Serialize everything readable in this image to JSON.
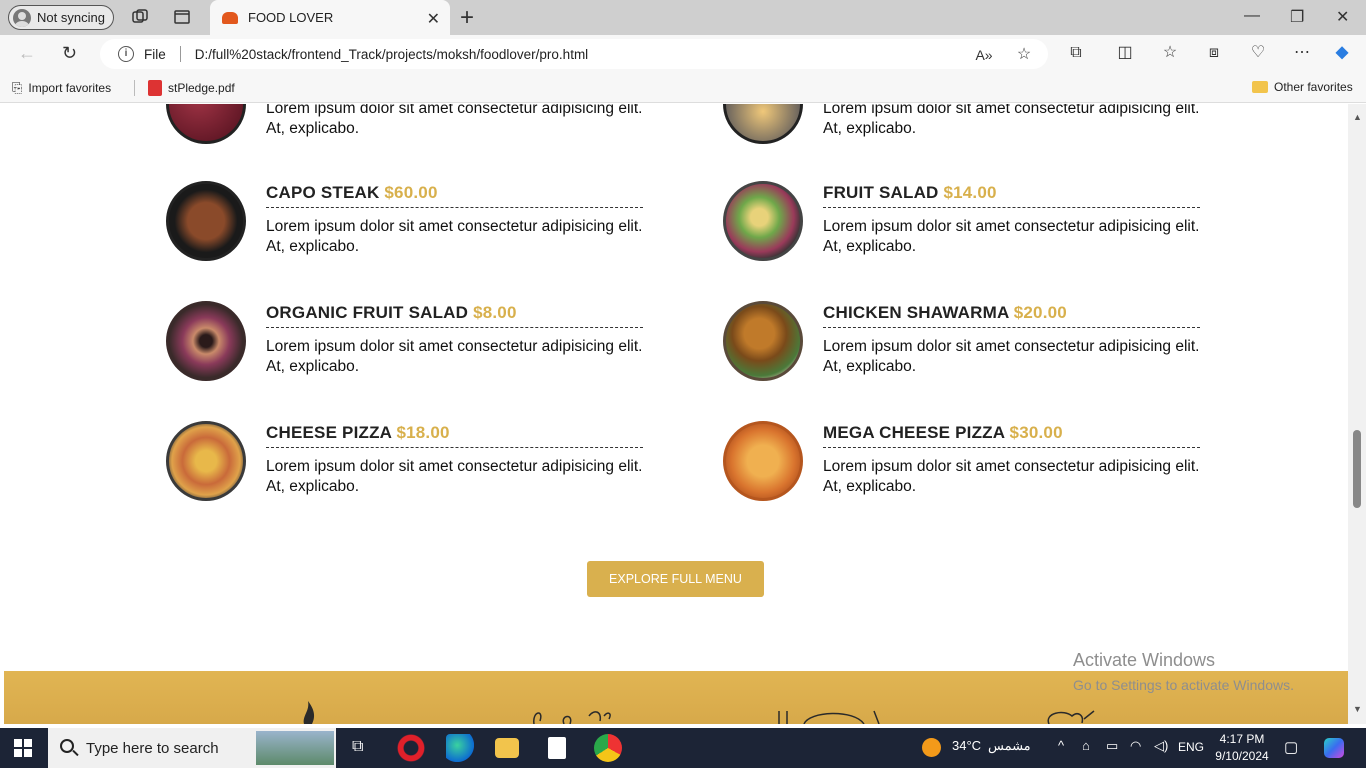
{
  "browser": {
    "sync_label": "Not syncing",
    "tab_title": "FOOD LOVER",
    "url_scheme": "File",
    "url": "D:/full%20stack/frontend_Track/projects/moksh/foodlover/pro.html",
    "bookmarks": [
      {
        "label": "Import favorites"
      },
      {
        "label": "stPledge.pdf"
      }
    ],
    "other_favorites": "Other favorites"
  },
  "menu": {
    "items": [
      {
        "name": "",
        "price": "",
        "desc": "Lorem ipsum dolor sit amet consectetur adipisicing elit. At, explicabo.",
        "plate_color": "#6b1a2b"
      },
      {
        "name": "",
        "price": "",
        "desc": "Lorem ipsum dolor sit amet consectetur adipisicing elit. At, explicabo.",
        "plate_color": "#2f3e66"
      },
      {
        "name": "CAPO STEAK",
        "price": "$60.00",
        "desc": "Lorem ipsum dolor sit amet consectetur adipisicing elit. At, explicabo.",
        "plate_color": "#4a2a1c"
      },
      {
        "name": "FRUIT SALAD",
        "price": "$14.00",
        "desc": "Lorem ipsum dolor sit amet consectetur adipisicing elit. At, explicabo.",
        "plate_color": "#6e9a45"
      },
      {
        "name": "ORGANIC FRUIT SALAD",
        "price": "$8.00",
        "desc": "Lorem ipsum dolor sit amet consectetur adipisicing elit. At, explicabo.",
        "plate_color": "#8b4a5a"
      },
      {
        "name": "CHICKEN SHAWARMA",
        "price": "$20.00",
        "desc": "Lorem ipsum dolor sit amet consectetur adipisicing elit. At, explicabo.",
        "plate_color": "#8a5a2a"
      },
      {
        "name": "CHEESE PIZZA",
        "price": "$18.00",
        "desc": "Lorem ipsum dolor sit amet consectetur adipisicing elit. At, explicabo.",
        "plate_color": "#d28a3a"
      },
      {
        "name": "MEGA CHEESE PIZZA",
        "price": "$30.00",
        "desc": "Lorem ipsum dolor sit amet consectetur adipisicing elit. At, explicabo.",
        "plate_color": "#d9742e"
      }
    ],
    "explore_label": "EXPLORE FULL MENU"
  },
  "watermark": {
    "line1": "Activate Windows",
    "line2": "Go to Settings to activate Windows."
  },
  "taskbar": {
    "search_placeholder": "Type here to search",
    "weather": "34°C",
    "weather_desc": "مشمس",
    "lang": "ENG",
    "time": "4:17 PM",
    "date": "9/10/2024"
  },
  "colors": {
    "accent": "#d9b04e",
    "price": "#d8b04c"
  }
}
